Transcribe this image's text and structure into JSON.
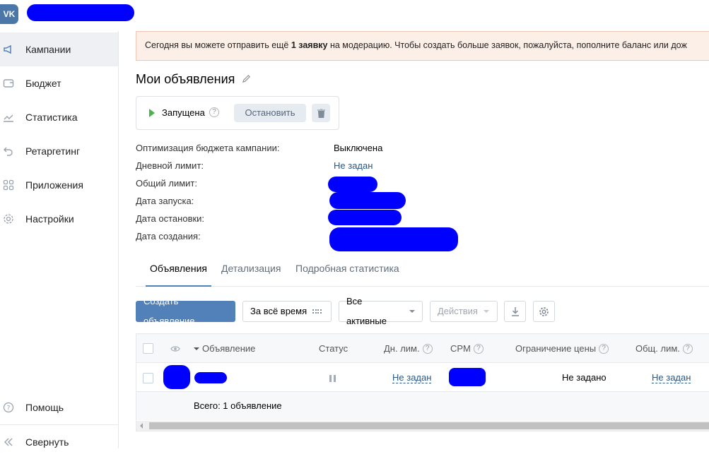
{
  "header": {
    "logo_text": "VK"
  },
  "sidebar": {
    "items": [
      {
        "label": "Кампании",
        "icon": "megaphone-icon"
      },
      {
        "label": "Бюджет",
        "icon": "wallet-icon"
      },
      {
        "label": "Статистика",
        "icon": "chart-line-icon"
      },
      {
        "label": "Ретаргетинг",
        "icon": "undo-arrow-icon"
      },
      {
        "label": "Приложения",
        "icon": "apps-grid-icon"
      },
      {
        "label": "Настройки",
        "icon": "gear-icon"
      }
    ],
    "help_label": "Помощь",
    "collapse_label": "Свернуть"
  },
  "notice": {
    "prefix": "Сегодня вы можете отправить ещё ",
    "bold": "1 заявку",
    "suffix": " на модерацию. Чтобы создать больше заявок, пожалуйста, пополните баланс или дож"
  },
  "page": {
    "title": "Мои объявления"
  },
  "status": {
    "label": "Запущена",
    "help": "?",
    "stop_label": "Остановить"
  },
  "props": [
    {
      "label": "Оптимизация бюджета кампании:",
      "value": "Выключена"
    },
    {
      "label": "Дневной лимит:",
      "value": "Не задан"
    },
    {
      "label": "Общий лимит:"
    },
    {
      "label": "Дата запуска:"
    },
    {
      "label": "Дата остановки:"
    },
    {
      "label": "Дата создания:"
    }
  ],
  "tabs": [
    "Объявления",
    "Детализация",
    "Подробная статистика"
  ],
  "toolbar": {
    "create_label": "Создать объявление",
    "period_label": "За всё время",
    "filter_label": "Все активные",
    "actions_label": "Действия"
  },
  "table": {
    "headers": {
      "ad": "Объявление",
      "status": "Статус",
      "daily_limit": "Дн. лим.",
      "cpm": "CPM",
      "price_limit": "Ограничение цены",
      "total_limit": "Общ. лим."
    },
    "row": {
      "daily_limit": "Не задан",
      "price_limit": "Не задано",
      "total_limit": "Не задан"
    },
    "footer": "Всего: 1 объявление"
  },
  "colors": {
    "accent": "#5181b8",
    "play": "#4bb34b",
    "link": "#2a5885",
    "notice_bg": "#fbefe8"
  }
}
